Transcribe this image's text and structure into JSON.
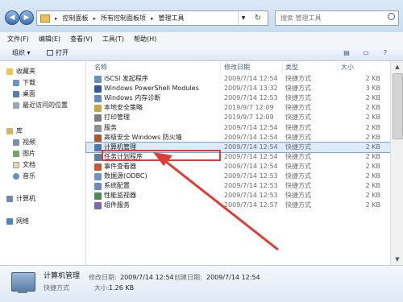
{
  "address": {
    "back_glyph": "◀",
    "forward_glyph": "▶",
    "breadcrumbs": [
      "控制面板",
      "所有控制面板项",
      "管理工具"
    ],
    "separator": "▸",
    "search_placeholder": "搜索 管理工具"
  },
  "menu": [
    "文件(F)",
    "编辑(E)",
    "查看(V)",
    "工具(T)",
    "帮助(H)"
  ],
  "toolbar": {
    "organize": "组织 ▾",
    "open": "打开"
  },
  "sidebar": {
    "favorites_header": "收藏夹",
    "favorites": [
      "下载",
      "桌面",
      "最近访问的位置"
    ],
    "library_header": "库",
    "library": [
      "视频",
      "图片",
      "文档",
      "音乐"
    ],
    "computer": "计算机",
    "network": "网络"
  },
  "columns": {
    "name": "名称",
    "date": "修改日期",
    "type": "类型",
    "size": "大小"
  },
  "files": [
    {
      "name": "iSCSI 发起程序",
      "date": "2009/7/14 12:54",
      "type": "快捷方式",
      "size": "2 KB",
      "color": "#6a8fc2"
    },
    {
      "name": "Windows PowerShell Modules",
      "date": "2009/7/14 13:32",
      "type": "快捷方式",
      "size": "3 KB",
      "color": "#2c5aa0"
    },
    {
      "name": "Windows 内存诊断",
      "date": "2009/7/14 12:53",
      "type": "快捷方式",
      "size": "2 KB",
      "color": "#5f8cc0"
    },
    {
      "name": "本地安全策略",
      "date": "2019/9/7 12:09",
      "type": "快捷方式",
      "size": "2 KB",
      "color": "#c7a541"
    },
    {
      "name": "打印管理",
      "date": "2019/9/7 12:09",
      "type": "快捷方式",
      "size": "2 KB",
      "color": "#7f7f7f"
    },
    {
      "name": "服务",
      "date": "2009/7/14 12:54",
      "type": "快捷方式",
      "size": "2 KB",
      "color": "#8a8f99"
    },
    {
      "name": "高级安全 Windows 防火墙",
      "date": "2009/7/14 12:54",
      "type": "快捷方式",
      "size": "2 KB",
      "color": "#b2502f"
    },
    {
      "name": "计算机管理",
      "date": "2009/7/14 12:54",
      "type": "快捷方式",
      "size": "2 KB",
      "color": "#4d79ad"
    },
    {
      "name": "任务计划程序",
      "date": "2009/7/14 12:54",
      "type": "快捷方式",
      "size": "2 KB",
      "color": "#5b7fa8"
    },
    {
      "name": "事件查看器",
      "date": "2009/7/14 12:54",
      "type": "快捷方式",
      "size": "2 KB",
      "color": "#c9582f"
    },
    {
      "name": "数据源(ODBC)",
      "date": "2009/7/14 12:53",
      "type": "快捷方式",
      "size": "2 KB",
      "color": "#6f93c7"
    },
    {
      "name": "系统配置",
      "date": "2009/7/14 12:53",
      "type": "快捷方式",
      "size": "2 KB",
      "color": "#6b8db8"
    },
    {
      "name": "性能监视器",
      "date": "2009/7/14 12:53",
      "type": "快捷方式",
      "size": "2 KB",
      "color": "#4f8a53"
    },
    {
      "name": "组件服务",
      "date": "2009/7/14 12:57",
      "type": "快捷方式",
      "size": "2 KB",
      "color": "#7a6aa8"
    }
  ],
  "details": {
    "name": "计算机管理",
    "type": "快捷方式",
    "modified_label": "修改日期:",
    "modified": "2009/7/14 12:54",
    "created_label": "创建日期:",
    "created": "2009/7/14 12:54",
    "size_label": "大小:",
    "size": "1.26 KB"
  },
  "selected_index": 7,
  "colors": {
    "highlight": "#e03c31",
    "selection": "#dcebfc"
  }
}
